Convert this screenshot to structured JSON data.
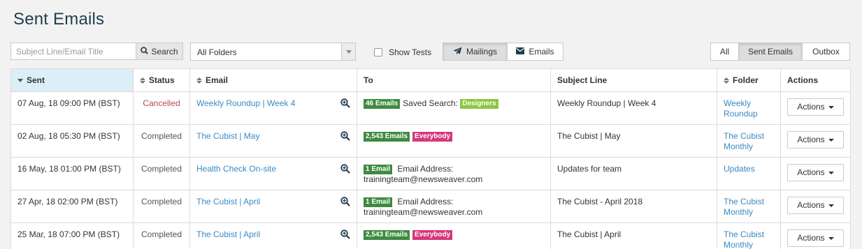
{
  "page": {
    "title": "Sent Emails"
  },
  "search": {
    "placeholder": "Subject Line/Email Title",
    "button_label": "Search"
  },
  "folder_select": {
    "value": "All Folders"
  },
  "show_tests": {
    "label": "Show Tests",
    "checked": false
  },
  "mode_toggle": {
    "mailings_label": "Mailings",
    "emails_label": "Emails",
    "active": "Mailings"
  },
  "view_toggle": {
    "all_label": "All",
    "sent_label": "Sent Emails",
    "outbox_label": "Outbox",
    "active": "Sent Emails"
  },
  "table": {
    "headers": {
      "sent": "Sent",
      "status": "Status",
      "email": "Email",
      "to": "To",
      "subject": "Subject Line",
      "folder": "Folder",
      "actions": "Actions"
    },
    "rows": [
      {
        "sent": "07 Aug, 18 09:00 PM (BST)",
        "status": "Cancelled",
        "email": "Weekly Roundup | Week 4",
        "to_badge": "46 Emails",
        "to_text": "Saved Search:",
        "to_tag": "Designers",
        "subject": "Weekly Roundup | Week 4",
        "folder": "Weekly Roundup",
        "action": "Actions"
      },
      {
        "sent": "02 Aug, 18 05:30 PM (BST)",
        "status": "Completed",
        "email": "The Cubist | May",
        "to_badge": "2,543 Emails",
        "to_text": "",
        "to_tag": "Everybody",
        "subject": "The Cubist | May",
        "folder": "The Cubist Monthly",
        "action": "Actions"
      },
      {
        "sent": "16 May, 18 01:00 PM (BST)",
        "status": "Completed",
        "email": "Health Check On-site",
        "to_badge": "1 Email",
        "to_text": "Email Address:",
        "to_email": "trainingteam@newsweaver.com",
        "subject": "Updates for team",
        "folder": "Updates",
        "action": "Actions"
      },
      {
        "sent": "27 Apr, 18 02:00 PM (BST)",
        "status": "Completed",
        "email": "The Cubist | April",
        "to_badge": "1 Email",
        "to_text": "Email Address:",
        "to_email": "trainingteam@newsweaver.com",
        "subject": "The Cubist - April 2018",
        "folder": "The Cubist Monthly",
        "action": "Actions"
      },
      {
        "sent": "25 Mar, 18 07:00 PM (BST)",
        "status": "Completed",
        "email": "The Cubist | April",
        "to_badge": "2,543 Emails",
        "to_text": "",
        "to_tag": "Everybody",
        "subject": "The Cubist | April",
        "folder": "The Cubist Monthly",
        "action": "Actions"
      }
    ]
  },
  "colors": {
    "title": "#1f3d4f",
    "link": "#3a8ac3",
    "cancelled": "#b84a4a",
    "badge_green": "#3d8b40",
    "badge_lime": "#8cc63f",
    "badge_pink": "#d6387a",
    "sorted_header": "#dceef8"
  },
  "icons": {
    "search": "search-icon",
    "zoom": "zoom-in-icon",
    "mailings": "paper-plane-icon",
    "emails": "envelope-icon",
    "caret": "caret-down-icon"
  }
}
